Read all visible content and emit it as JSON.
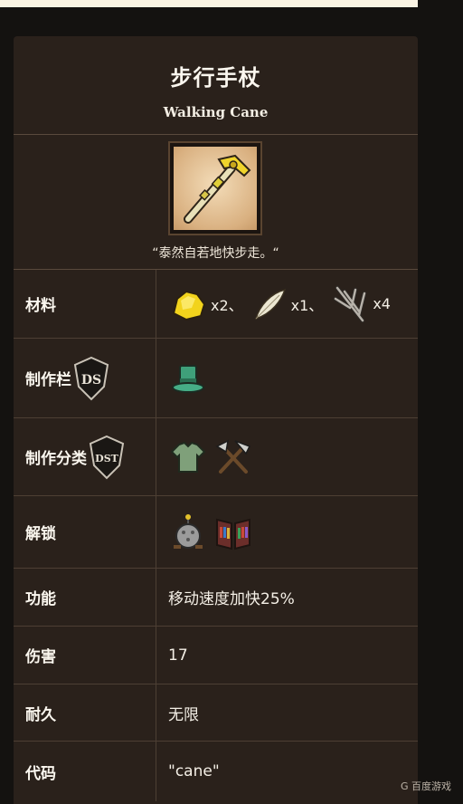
{
  "header": {
    "title_cn": "步行手杖",
    "title_en": "Walking Cane"
  },
  "item": {
    "quote": "“泰然自若地快步走。“"
  },
  "rows": {
    "materials": {
      "label": "材料",
      "items": [
        {
          "icon": "gold-nugget-icon",
          "count": "x2、"
        },
        {
          "icon": "feather-icon",
          "count": "x1、"
        },
        {
          "icon": "twigs-icon",
          "count": "x4"
        }
      ]
    },
    "craft_tab": {
      "label": "制作栏",
      "badge": "DS",
      "icon": "top-hat-icon"
    },
    "craft_category": {
      "label": "制作分类",
      "badge": "DST",
      "icons": [
        "clothing-icon",
        "tools-icon"
      ]
    },
    "unlock": {
      "label": "解锁",
      "icons": [
        "science-machine-icon",
        "bookshelf-icon"
      ]
    },
    "function": {
      "label": "功能",
      "value": "移动速度加快25%"
    },
    "damage": {
      "label": "伤害",
      "value": "17"
    },
    "durability": {
      "label": "耐久",
      "value": "无限"
    },
    "code": {
      "label": "代码",
      "value": "\"cane\""
    }
  },
  "watermark": "G 百度游戏",
  "colors": {
    "card": "#2a211b",
    "border": "#4d3f34",
    "gold": "#e8c31a"
  }
}
